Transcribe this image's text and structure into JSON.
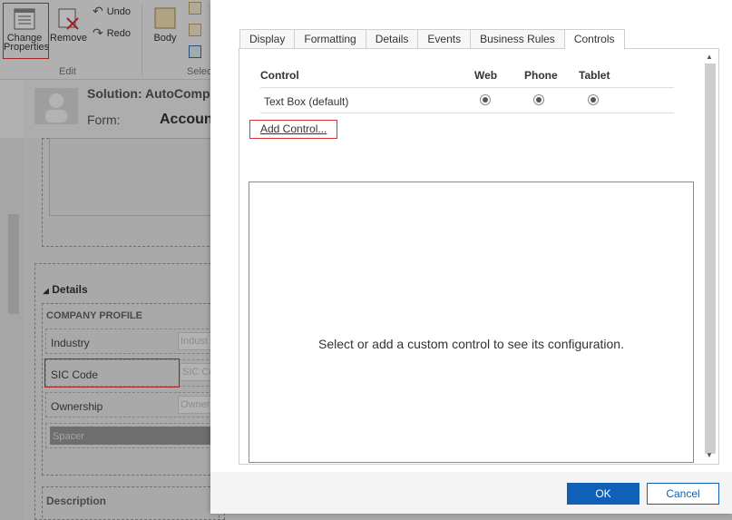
{
  "ribbon": {
    "change_properties_line1": "Change",
    "change_properties_line2": "Properties",
    "remove": "Remove",
    "undo": "Undo",
    "redo": "Redo",
    "body": "Body",
    "group_edit": "Edit",
    "group_select": "Selec"
  },
  "solution": {
    "solution_label": "Solution: AutoComple",
    "form_label": "Form:",
    "form_name": "Accoun"
  },
  "form": {
    "details_title": "Details",
    "company_profile": "COMPANY PROFILE",
    "fields": [
      {
        "label": "Industry",
        "placeholder": "Indust"
      },
      {
        "label": "SIC Code",
        "placeholder": "SIC Co"
      },
      {
        "label": "Ownership",
        "placeholder": "Owner"
      }
    ],
    "spacer": "Spacer",
    "description_title": "Description"
  },
  "dialog": {
    "tabs": [
      "Display",
      "Formatting",
      "Details",
      "Events",
      "Business Rules",
      "Controls"
    ],
    "active_tab": "Controls",
    "controls_table": {
      "headers": {
        "control": "Control",
        "web": "Web",
        "phone": "Phone",
        "tablet": "Tablet"
      },
      "rows": [
        {
          "control": "Text Box (default)"
        }
      ]
    },
    "add_control": "Add Control...",
    "config_message": "Select or add a custom control to see its configuration.",
    "ok": "OK",
    "cancel": "Cancel"
  },
  "colors": {
    "primary": "#1160b7",
    "highlight": "#d33333"
  }
}
